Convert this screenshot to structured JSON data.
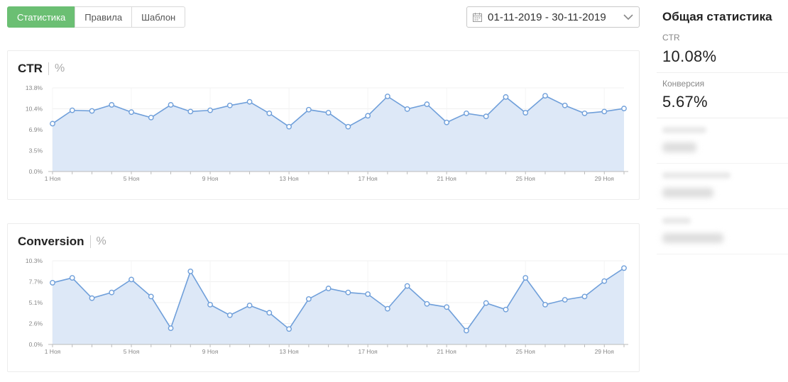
{
  "tabs": [
    {
      "label": "Статистика",
      "active": true
    },
    {
      "label": "Правила",
      "active": false
    },
    {
      "label": "Шаблон",
      "active": false
    }
  ],
  "date_range": {
    "value": "01-11-2019 - 30-11-2019"
  },
  "ctr_card": {
    "title": "CTR",
    "unit": "%"
  },
  "conversion_card": {
    "title": "Conversion",
    "unit": "%"
  },
  "sidebar": {
    "title": "Общая статистика",
    "stats": [
      {
        "label": "CTR",
        "value": "10.08%"
      },
      {
        "label": "Конверсия",
        "value": "5.67%"
      }
    ]
  },
  "colors": {
    "accent": "#6bbf73",
    "line": "#6f9fda",
    "fill": "#dde8f7"
  },
  "chart_data": [
    {
      "type": "area",
      "title": "CTR",
      "ylabel": "%",
      "x_tick_labels": [
        "1 Ноя",
        "5 Ноя",
        "9 Ноя",
        "13 Ноя",
        "17 Ноя",
        "21 Ноя",
        "25 Ноя",
        "29 Ноя"
      ],
      "y_tick_labels": [
        "0.0%",
        "3.5%",
        "6.9%",
        "10.4%",
        "13.8%"
      ],
      "ylim": [
        0,
        13.8
      ],
      "x": [
        1,
        2,
        3,
        4,
        5,
        6,
        7,
        8,
        9,
        10,
        11,
        12,
        13,
        14,
        15,
        16,
        17,
        18,
        19,
        20,
        21,
        22,
        23,
        24,
        25,
        26,
        27,
        28,
        29,
        30
      ],
      "values": [
        7.9,
        10.1,
        10.0,
        11.0,
        9.8,
        8.9,
        11.0,
        9.9,
        10.1,
        10.9,
        11.5,
        9.6,
        7.4,
        10.2,
        9.7,
        7.4,
        9.2,
        12.4,
        10.3,
        11.1,
        8.1,
        9.6,
        9.1,
        12.3,
        9.7,
        12.5,
        10.9,
        9.6,
        9.9,
        10.4
      ],
      "grid": true
    },
    {
      "type": "area",
      "title": "Conversion",
      "ylabel": "%",
      "x_tick_labels": [
        "1 Ноя",
        "5 Ноя",
        "9 Ноя",
        "13 Ноя",
        "17 Ноя",
        "21 Ноя",
        "25 Ноя",
        "29 Ноя"
      ],
      "y_tick_labels": [
        "0.0%",
        "2.6%",
        "5.1%",
        "7.7%",
        "10.3%"
      ],
      "ylim": [
        0,
        10.3
      ],
      "x": [
        1,
        2,
        3,
        4,
        5,
        6,
        7,
        8,
        9,
        10,
        11,
        12,
        13,
        14,
        15,
        16,
        17,
        18,
        19,
        20,
        21,
        22,
        23,
        24,
        25,
        26,
        27,
        28,
        29,
        30
      ],
      "values": [
        7.6,
        8.2,
        5.7,
        6.4,
        8.0,
        5.9,
        2.0,
        9.0,
        4.9,
        3.6,
        4.8,
        3.9,
        1.9,
        5.6,
        6.9,
        6.4,
        6.2,
        4.4,
        7.2,
        5.0,
        4.6,
        1.7,
        5.1,
        4.3,
        8.2,
        4.9,
        5.5,
        5.9,
        7.8,
        9.4
      ],
      "grid": true
    }
  ]
}
